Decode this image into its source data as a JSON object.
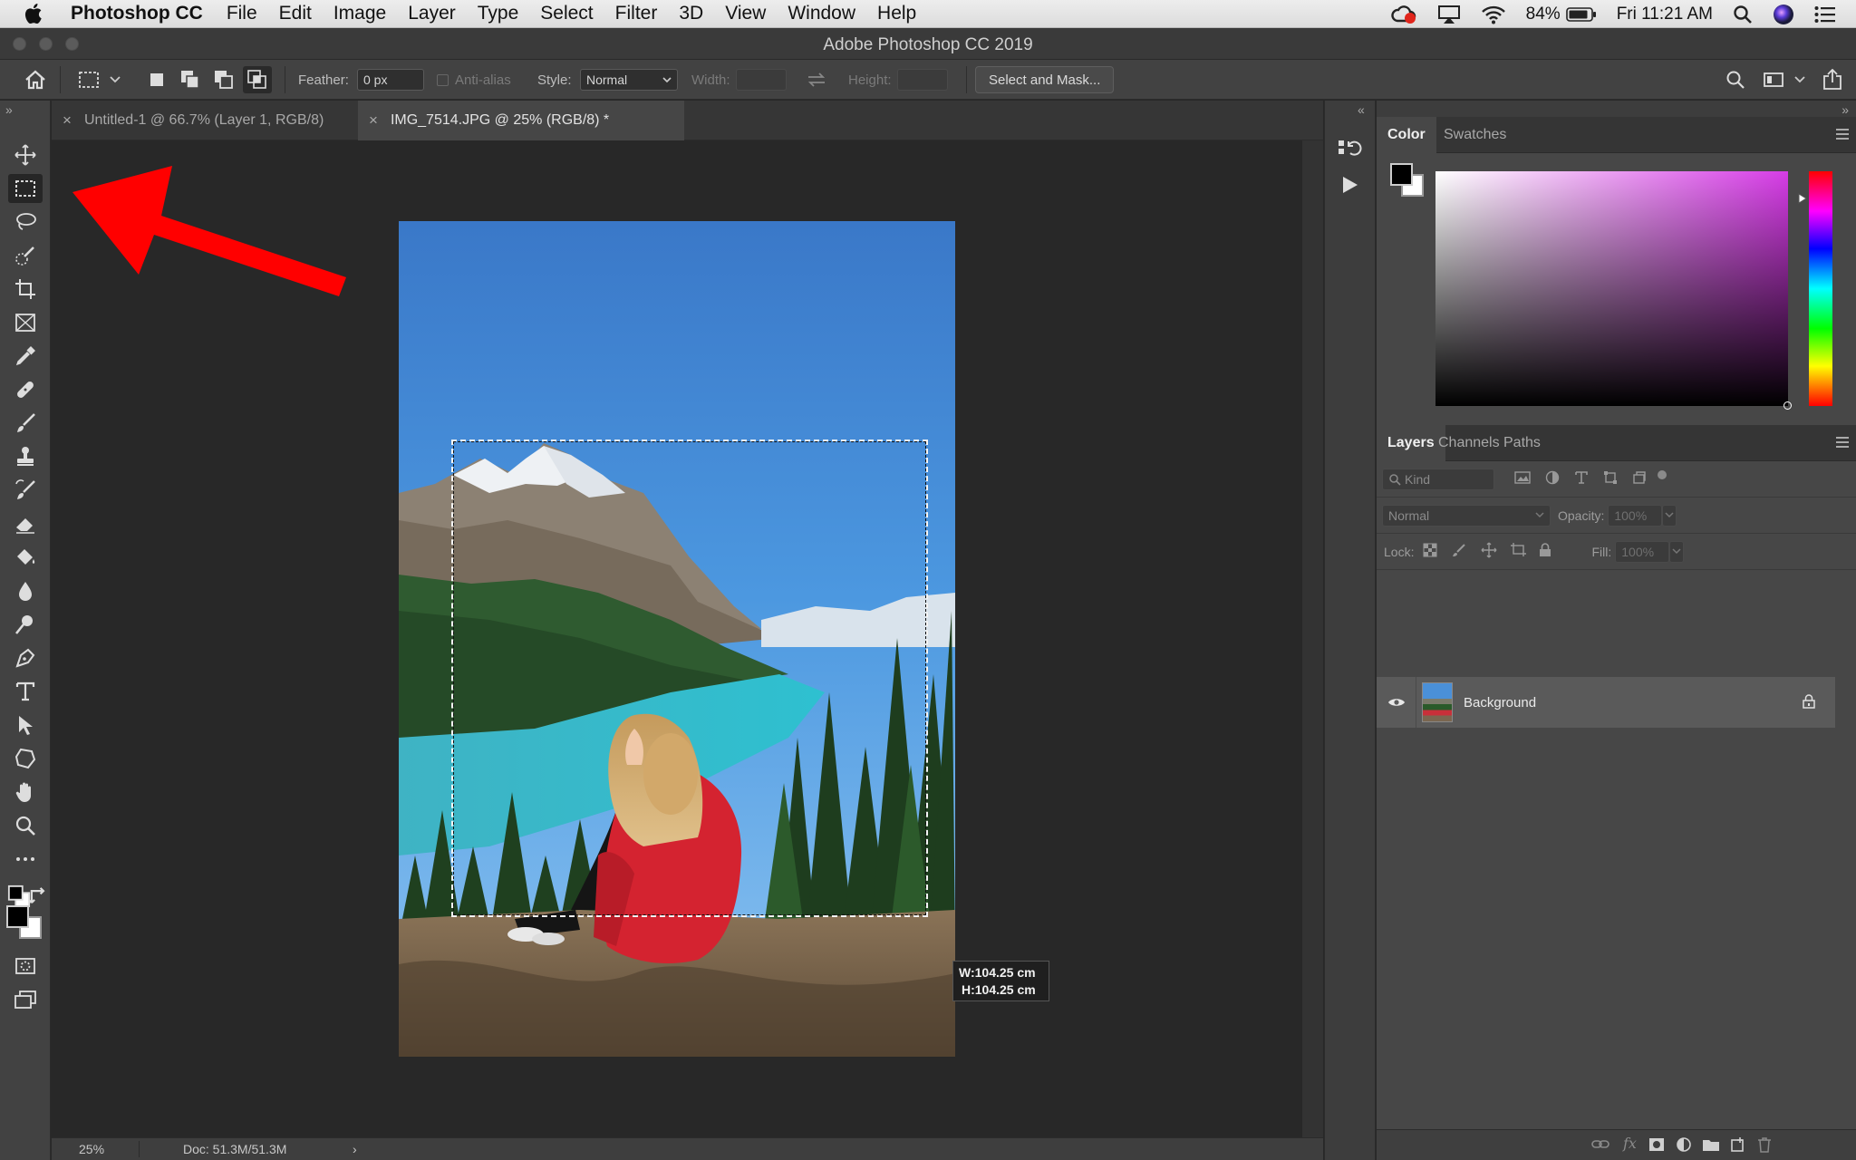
{
  "menubar": {
    "app_name": "Photoshop CC",
    "menus": [
      "File",
      "Edit",
      "Image",
      "Layer",
      "Type",
      "Select",
      "Filter",
      "3D",
      "View",
      "Window",
      "Help"
    ],
    "battery": "84%",
    "clock": "Fri 11:21 AM"
  },
  "window": {
    "title": "Adobe Photoshop CC 2019"
  },
  "options": {
    "feather_label": "Feather:",
    "feather_value": "0 px",
    "antialias_label": "Anti-alias",
    "style_label": "Style:",
    "style_value": "Normal",
    "width_label": "Width:",
    "height_label": "Height:",
    "select_mask_label": "Select and Mask..."
  },
  "tabs": [
    {
      "label": "Untitled-1 @ 66.7% (Layer 1, RGB/8)"
    },
    {
      "label": "IMG_7514.JPG @ 25% (RGB/8) *"
    }
  ],
  "canvas": {
    "tooltip_w": "W:104.25 cm",
    "tooltip_h": "H:104.25 cm"
  },
  "status": {
    "zoom": "25%",
    "doc": "Doc: 51.3M/51.3M"
  },
  "color_panel": {
    "tabs": [
      "Color",
      "Swatches"
    ],
    "foreground": "#000000",
    "background": "#ffffff"
  },
  "layers_panel": {
    "tabs": [
      "Layers",
      "Channels",
      "Paths"
    ],
    "filter_placeholder": "Kind",
    "blend_mode": "Normal",
    "opacity_label": "Opacity:",
    "opacity_value": "100%",
    "lock_label": "Lock:",
    "fill_label": "Fill:",
    "fill_value": "100%",
    "layers": [
      {
        "name": "Background",
        "locked": true,
        "visible": true
      }
    ]
  },
  "toolbar_icons": [
    "move-icon",
    "marquee-icon",
    "lasso-icon",
    "quick-select-icon",
    "crop-icon",
    "frame-icon",
    "eyedropper-icon",
    "healing-icon",
    "brush-icon",
    "stamp-icon",
    "history-brush-icon",
    "eraser-icon",
    "paint-bucket-icon",
    "blur-icon",
    "dodge-icon",
    "pen-icon",
    "type-icon",
    "path-select-icon",
    "shape-icon",
    "hand-icon",
    "zoom-icon",
    "more-tools-icon"
  ],
  "annotation": {
    "arrow_color": "#ff0000"
  }
}
